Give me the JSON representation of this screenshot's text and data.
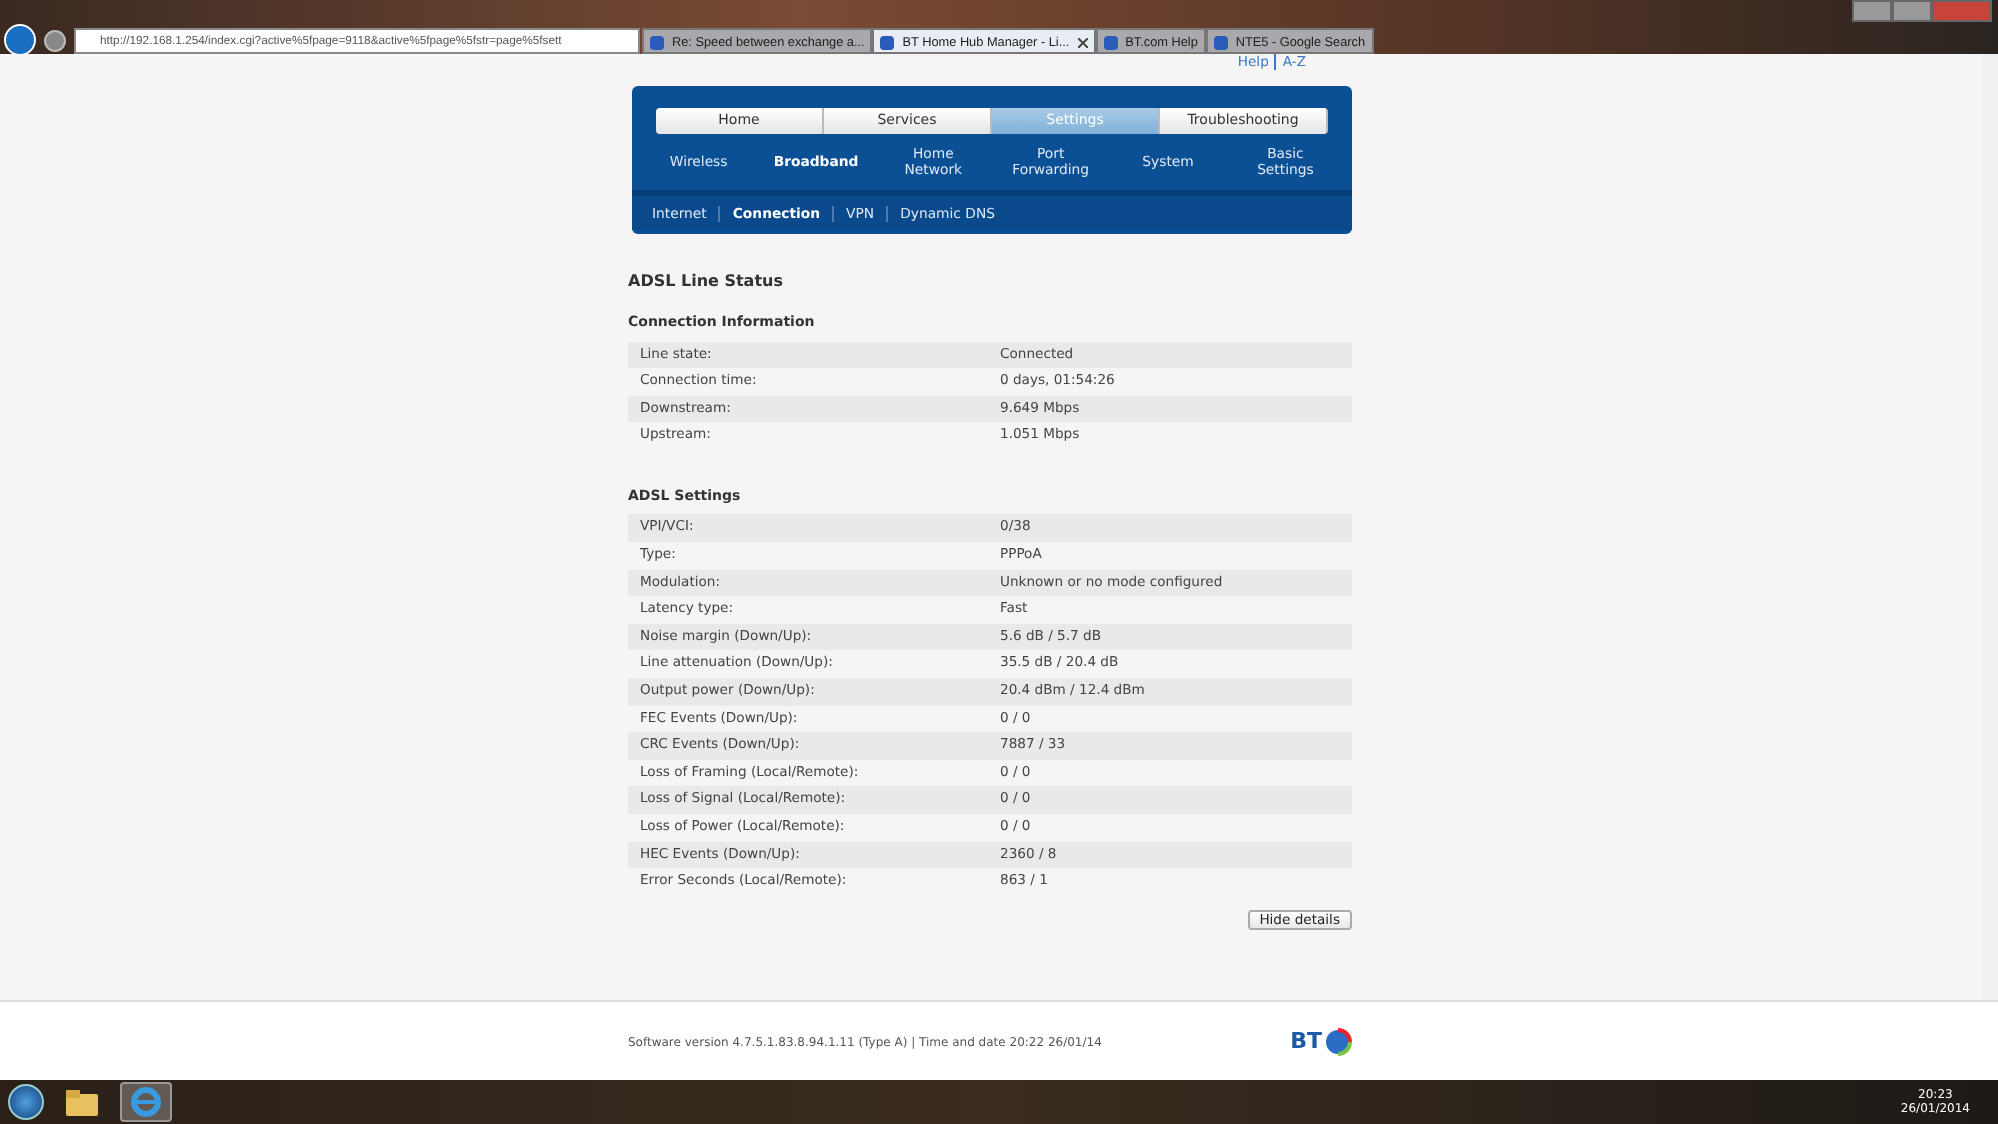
{
  "browser": {
    "address": "http://192.168.1.254/index.cgi?active%5fpage=9118&active%5fpage%5fstr=page%5fsett",
    "tabs": [
      {
        "title": "Re: Speed between exchange a...",
        "selected": false,
        "closable": false
      },
      {
        "title": "BT Home Hub Manager - Li...",
        "selected": true,
        "closable": true
      },
      {
        "title": "BT.com Help",
        "selected": false,
        "closable": false
      },
      {
        "title": "NTE5 - Google Search",
        "selected": false,
        "closable": false
      }
    ]
  },
  "top_links": [
    "Help",
    "A-Z"
  ],
  "main_tabs": [
    {
      "label": "Home",
      "selected": false
    },
    {
      "label": "Services",
      "selected": false
    },
    {
      "label": "Settings",
      "selected": true
    },
    {
      "label": "Troubleshooting",
      "selected": false
    }
  ],
  "settings_menu": [
    {
      "label": "Wireless",
      "selected": false
    },
    {
      "label": "Broadband",
      "selected": true
    },
    {
      "label": "Home\nNetwork",
      "selected": false
    },
    {
      "label": "Port\nForwarding",
      "selected": false
    },
    {
      "label": "System",
      "selected": false
    },
    {
      "label": "Basic\nSettings",
      "selected": false
    }
  ],
  "broadband_menu": [
    {
      "label": "Internet",
      "selected": false
    },
    {
      "label": "Connection",
      "selected": true
    },
    {
      "label": "VPN",
      "selected": false
    },
    {
      "label": "Dynamic DNS",
      "selected": false
    }
  ],
  "heading": "ADSL Line Status",
  "sections": [
    {
      "title": "Connection Information",
      "rows": [
        {
          "label": "Line state:",
          "value": "Connected"
        },
        {
          "label": "Connection time:",
          "value": "0 days, 01:54:26"
        },
        {
          "label": "Downstream:",
          "value": "9.649 Mbps"
        },
        {
          "label": "Upstream:",
          "value": "1.051 Mbps"
        }
      ]
    },
    {
      "title": "ADSL Settings",
      "rows": [
        {
          "label": "VPI/VCI:",
          "value": "0/38"
        },
        {
          "label": "Type:",
          "value": "PPPoA"
        },
        {
          "label": "Modulation:",
          "value": "Unknown or no mode configured"
        },
        {
          "label": "Latency type:",
          "value": "Fast"
        },
        {
          "label": "Noise margin (Down/Up):",
          "value": "5.6 dB / 5.7 dB"
        },
        {
          "label": "Line attenuation (Down/Up):",
          "value": "35.5 dB / 20.4 dB"
        },
        {
          "label": "Output power (Down/Up):",
          "value": "20.4 dBm / 12.4 dBm"
        },
        {
          "label": "FEC Events (Down/Up):",
          "value": "0 / 0"
        },
        {
          "label": "CRC Events (Down/Up):",
          "value": "7887 / 33"
        },
        {
          "label": "Loss of Framing (Local/Remote):",
          "value": "0 / 0"
        },
        {
          "label": "Loss of Signal (Local/Remote):",
          "value": "0 / 0"
        },
        {
          "label": "Loss of Power (Local/Remote):",
          "value": "0 / 0"
        },
        {
          "label": "HEC Events (Down/Up):",
          "value": "2360 / 8"
        },
        {
          "label": "Error Seconds (Local/Remote):",
          "value": "863 / 1"
        }
      ]
    }
  ],
  "details_button": "Hide details",
  "footer": "Software version 4.7.5.1.83.8.94.1.11 (Type A) | Time and date 20:22 26/01/14",
  "logo": "BT",
  "taskbar": {
    "time": "20:23",
    "date": "26/01/2014"
  }
}
